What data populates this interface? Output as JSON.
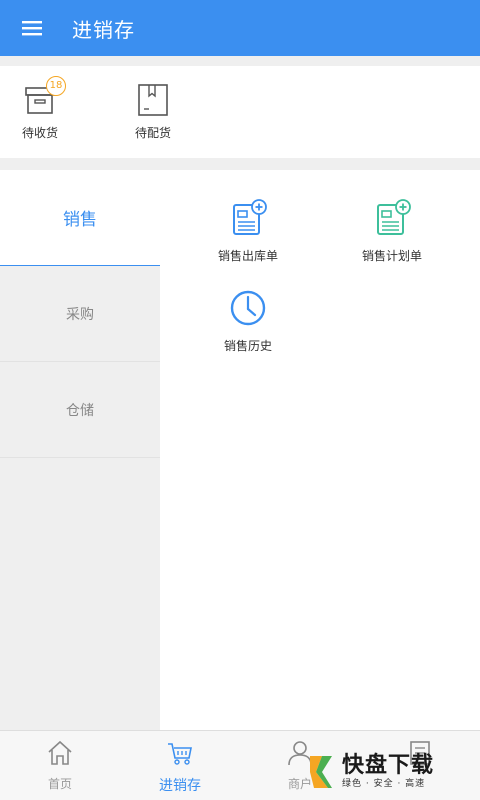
{
  "header": {
    "title": "进销存"
  },
  "quick_actions": [
    {
      "label": "待收货",
      "icon": "box-icon",
      "badge": "18"
    },
    {
      "label": "待配货",
      "icon": "package-icon"
    }
  ],
  "side_menu": [
    {
      "label": "销售",
      "active": true
    },
    {
      "label": "采购",
      "active": false
    },
    {
      "label": "仓储",
      "active": false
    }
  ],
  "sales_actions": [
    {
      "label": "销售出库单",
      "icon": "document-add-icon",
      "color": "#3b8ff0"
    },
    {
      "label": "销售计划单",
      "icon": "document-add-icon",
      "color": "#3dbf9b"
    },
    {
      "label": "销售历史",
      "icon": "clock-icon",
      "color": "#3b8ff0"
    }
  ],
  "bottom_nav": [
    {
      "label": "首页",
      "icon": "home-icon",
      "active": false
    },
    {
      "label": "进销存",
      "icon": "cart-icon",
      "active": true
    },
    {
      "label": "商户",
      "icon": "user-icon",
      "active": false
    },
    {
      "label": "",
      "icon": "document-icon",
      "active": false
    }
  ],
  "watermark": {
    "brand": "快盘下载",
    "tagline": "绿色 · 安全 · 高速"
  },
  "colors": {
    "primary": "#3b8ff0",
    "accent_green": "#3dbf9b",
    "badge": "#f5a623"
  }
}
